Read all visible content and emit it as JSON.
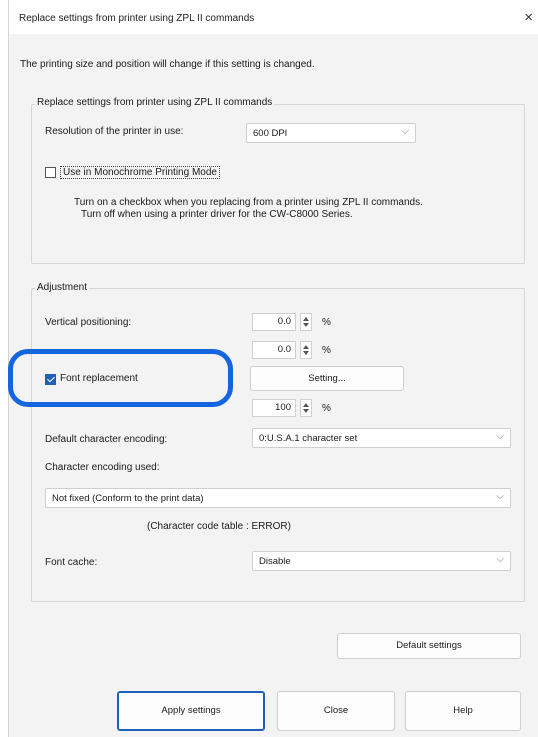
{
  "window": {
    "title": "Replace settings from printer using ZPL II commands",
    "close_glyph": "×"
  },
  "notice": "The printing size and position will change if this setting is changed.",
  "zpl_group": {
    "label": "Replace settings from printer using ZPL II commands",
    "resolution_label": "Resolution of the printer in use:",
    "resolution_value": "600 DPI",
    "mono_label": "Use in Monochrome Printing Mode",
    "mono_checked": false,
    "help_line1": "Turn on a checkbox when you replacing from a printer using ZPL II commands.",
    "help_line2": "Turn off when using a printer driver for the CW-C8000 Series."
  },
  "adjustment": {
    "label": "Adjustment",
    "vertical_label": "Vertical positioning:",
    "vertical_value": "0.0",
    "horizontal_value": "0.0",
    "percent": "%",
    "font_replacement_label": "Font replacement",
    "font_replacement_checked": true,
    "setting_button": "Setting...",
    "scale_value": "100",
    "default_encoding_label": "Default character encoding:",
    "default_encoding_value": "0:U.S.A.1 character set",
    "encoding_used_label": "Character encoding used:",
    "encoding_used_value": "Not fixed (Conform to the print data)",
    "code_table_note": "(Character code table : ERROR)",
    "font_cache_label": "Font cache:",
    "font_cache_value": "Disable"
  },
  "buttons": {
    "default_settings": "Default settings",
    "apply": "Apply settings",
    "close": "Close",
    "help": "Help"
  },
  "icons": {
    "chevron": "⌵",
    "close": "close-icon"
  },
  "colors": {
    "accent": "#1e5fb8",
    "highlight": "#1565e0"
  }
}
